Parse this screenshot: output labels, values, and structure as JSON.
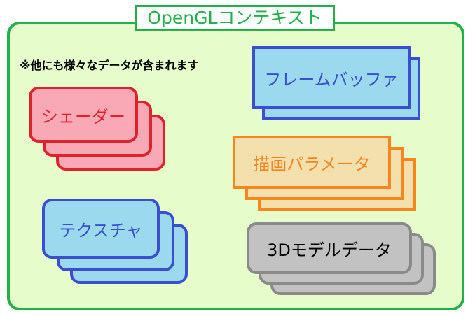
{
  "context": {
    "title": "OpenGLコンテキスト",
    "note": "※他にも様々なデータが含まれます"
  },
  "items": {
    "shader": "シェーダー",
    "texture": "テクスチャ",
    "framebuffer": "フレームバッファ",
    "draw_params": "描画パラメータ",
    "model_data": "3Dモデルデータ"
  },
  "colors": {
    "context_border": "#22b04a",
    "context_fill": "#e6fccb",
    "shader": "#e0222c",
    "texture": "#3a4fd0",
    "framebuffer": "#3a4fd0",
    "draw_params": "#f7861f",
    "model_data": "#8a8a8a"
  }
}
